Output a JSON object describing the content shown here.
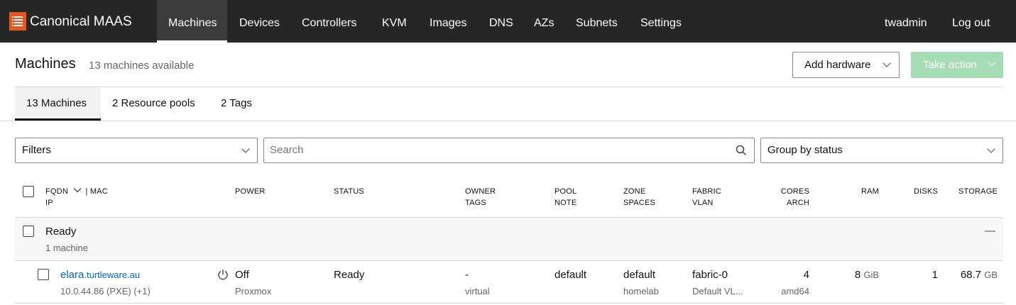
{
  "nav": {
    "brand": "Canonical MAAS",
    "items": [
      "Machines",
      "Devices",
      "Controllers",
      "KVM",
      "Images",
      "DNS",
      "AZs",
      "Subnets",
      "Settings"
    ],
    "user": "twadmin",
    "logout": "Log out"
  },
  "header": {
    "title": "Machines",
    "subtitle": "13 machines available",
    "add_hardware": "Add hardware",
    "take_action": "Take action"
  },
  "tabs": [
    "13 Machines",
    "2 Resource pools",
    "2 Tags"
  ],
  "filters": {
    "filters_label": "Filters",
    "search_placeholder": "Search",
    "group_by": "Group by status"
  },
  "columns": {
    "fqdn": "FQDN",
    "mac": "| MAC",
    "ip": "IP",
    "power": "POWER",
    "status": "STATUS",
    "owner": "OWNER",
    "tags": "TAGS",
    "pool": "POOL",
    "note": "NOTE",
    "zone": "ZONE",
    "spaces": "SPACES",
    "fabric": "FABRIC",
    "vlan": "VLAN",
    "cores": "CORES",
    "arch": "ARCH",
    "ram": "RAM",
    "disks": "DISKS",
    "storage": "STORAGE"
  },
  "group": {
    "name": "Ready",
    "count": "1 machine",
    "collapse": "—"
  },
  "machine": {
    "hostname": "elara",
    "domain": ".turtleware.au",
    "ip": "10.0.44.86 (PXE) (+1)",
    "power": "Off",
    "power_type": "Proxmox",
    "status": "Ready",
    "owner": "-",
    "tags": "virtual",
    "pool": "default",
    "zone": "default",
    "spaces": "homelab",
    "fabric": "fabric-0",
    "vlan": "Default VL...",
    "cores": "4",
    "arch": "amd64",
    "ram": "8",
    "ram_unit": "GiB",
    "disks": "1",
    "storage": "68.7",
    "storage_unit": "GB"
  },
  "colors": {
    "navbar": "#262626",
    "brand_orange": "#e95420",
    "take_action_bg": "#a5dcb6",
    "link": "#0066cc"
  }
}
